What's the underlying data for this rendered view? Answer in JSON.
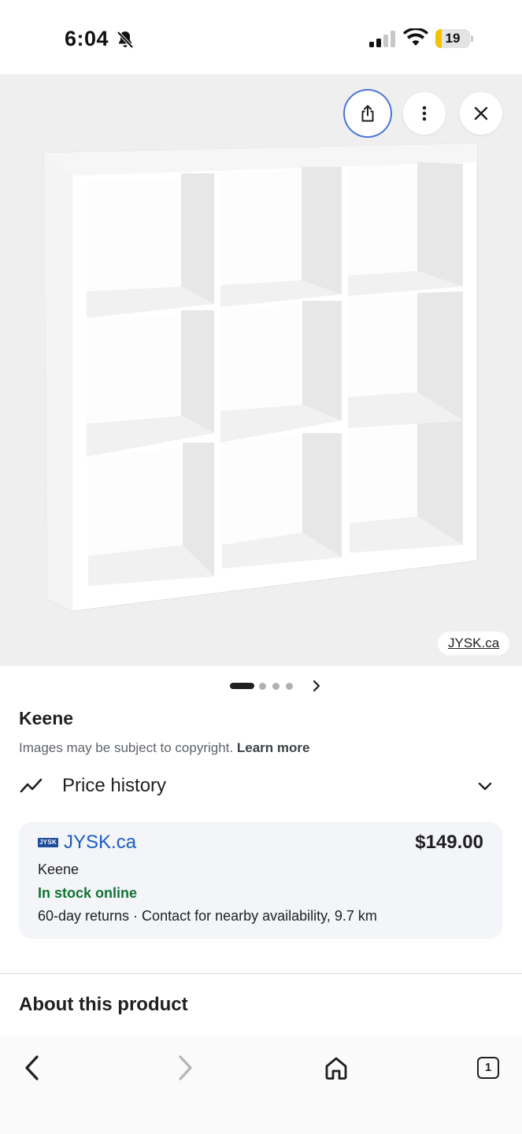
{
  "status_bar": {
    "time": "6:04",
    "battery_level": "19",
    "battery_fraction": 0.19,
    "battery_color": "#f5c400",
    "icons": [
      "bell-slash-icon",
      "cellular-signal-icon",
      "wifi-icon",
      "battery-icon"
    ]
  },
  "image_viewer": {
    "actions": [
      "share-icon",
      "more-vertical-icon",
      "close-icon"
    ],
    "source_label": "JYSK.ca",
    "carousel": {
      "total_images": 4,
      "current_index": 1
    }
  },
  "product": {
    "title": "Keene",
    "copyright_text": "Images may be subject to copyright. ",
    "learn_more_label": "Learn more"
  },
  "price_history": {
    "label": "Price history",
    "icon": "trend-line-icon",
    "expand_icon": "chevron-down-icon"
  },
  "offer": {
    "merchant_logo_text": "JYSK",
    "merchant_name": "JYSK.ca",
    "price": "$149.00",
    "product_name": "Keene",
    "stock_status": "In stock online",
    "details": "60-day returns · Contact for nearby availability, 9.7 km",
    "link_color": "#1a5cc2",
    "stock_color": "#137333"
  },
  "about": {
    "heading": "About this product"
  },
  "bottom_toolbar": {
    "items": [
      "back-icon",
      "forward-icon",
      "home-icon",
      "tabs-icon"
    ],
    "tab_count": "1"
  }
}
